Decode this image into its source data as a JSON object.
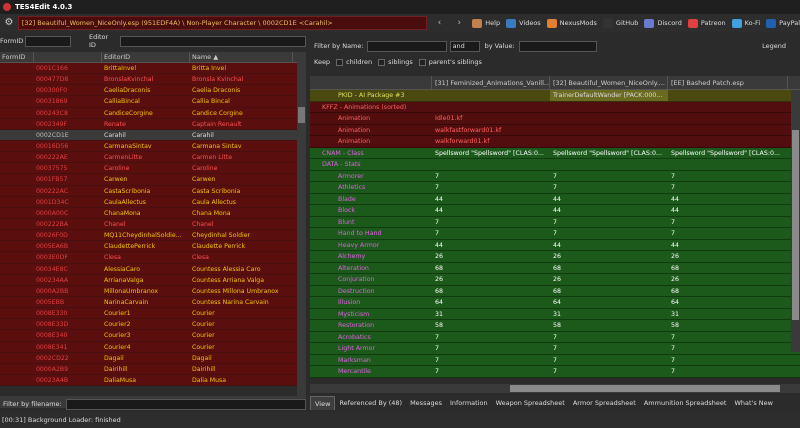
{
  "window": {
    "title": "TES4Edit 4.0.3"
  },
  "toolbar": {
    "path": "[32] Beautiful_Women_NiceOnly.esp (951EDF4A) \\ Non-Player Character \\ 0002CD1E <Carahil>",
    "buttons": [
      {
        "label": "Help",
        "icon": "book-icon",
        "color": "#c08050"
      },
      {
        "label": "Videos",
        "icon": "video-icon",
        "color": "#3a7ac0"
      },
      {
        "label": "NexusMods",
        "icon": "nexus-icon",
        "color": "#e08030"
      },
      {
        "label": "GitHub",
        "icon": "github-icon",
        "color": "#333333"
      },
      {
        "label": "Discord",
        "icon": "discord-icon",
        "color": "#6a7ad0"
      },
      {
        "label": "Patreon",
        "icon": "patreon-icon",
        "color": "#e04040"
      },
      {
        "label": "Ko-Fi",
        "icon": "kofi-icon",
        "color": "#40a0e0"
      },
      {
        "label": "PayPal",
        "icon": "paypal-icon",
        "color": "#2060b0"
      }
    ]
  },
  "left": {
    "formid_label": "FormID",
    "editorid_label": "Editor ID",
    "columns": [
      "FormID",
      "EditorID",
      "Name ▲"
    ],
    "rows": [
      {
        "id": "0001C166",
        "eid": "BrittaInvel",
        "name": "Britta Invel",
        "red": false
      },
      {
        "id": "000477D8",
        "eid": "BronslaKvinchal",
        "name": "Bronsla Kvinchal",
        "red": true
      },
      {
        "id": "000300F0",
        "eid": "CaeliaDraconis",
        "name": "Caelia Draconis",
        "red": false
      },
      {
        "id": "00031869",
        "eid": "CalliaBincal",
        "name": "Callia Bincal",
        "red": false
      },
      {
        "id": "000243C8",
        "eid": "CandiceCorgine",
        "name": "Candice Corgine",
        "red": false
      },
      {
        "id": "0002349F",
        "eid": "Renate",
        "name": "Captain Renault",
        "red": true
      },
      {
        "id": "0002CD1E",
        "eid": "Carahil",
        "name": "Carahil",
        "red": false,
        "sel": true
      },
      {
        "id": "00016D56",
        "eid": "CarmanaSintav",
        "name": "Carmana Sintav",
        "red": false
      },
      {
        "id": "000222AE",
        "eid": "CarmenLitte",
        "name": "Carmen Litte",
        "red": true
      },
      {
        "id": "00037575",
        "eid": "Caroline",
        "name": "Caroline",
        "red": true
      },
      {
        "id": "0001FB57",
        "eid": "Carwen",
        "name": "Carwen",
        "red": false
      },
      {
        "id": "000222AC",
        "eid": "CastaScribonia",
        "name": "Casta Scribonia",
        "red": false
      },
      {
        "id": "0001D34C",
        "eid": "CaulaAllectus",
        "name": "Caula Allectus",
        "red": false
      },
      {
        "id": "0000A00C",
        "eid": "ChanaMona",
        "name": "Chana Mona",
        "red": false
      },
      {
        "id": "000222BA",
        "eid": "Chanel",
        "name": "Chanel",
        "red": true
      },
      {
        "id": "00026F0D",
        "eid": "MQ11CheydinhalSoldie...",
        "name": "Cheydinhal Soldier",
        "red": false
      },
      {
        "id": "0005EA6B",
        "eid": "ClaudettePerrick",
        "name": "Claudette Perrick",
        "red": false
      },
      {
        "id": "0003E0DF",
        "eid": "Clesa",
        "name": "Clesa",
        "red": true
      },
      {
        "id": "00034E8C",
        "eid": "AlessiaCaro",
        "name": "Countess Alessia Caro",
        "red": false
      },
      {
        "id": "000234AA",
        "eid": "ArrianaValga",
        "name": "Countess Arriana Valga",
        "red": false
      },
      {
        "id": "0000A2BB",
        "eid": "MillonaUmbranox",
        "name": "Countess Millona Umbranox",
        "red": false
      },
      {
        "id": "0005EBB",
        "eid": "NarinaCarvain",
        "name": "Countess Narina Carvain",
        "red": false
      },
      {
        "id": "0008E330",
        "eid": "Courier1",
        "name": "Courier",
        "red": false
      },
      {
        "id": "0008E33D",
        "eid": "Courier2",
        "name": "Courier",
        "red": false
      },
      {
        "id": "0008E340",
        "eid": "Courier3",
        "name": "Courier",
        "red": false
      },
      {
        "id": "0008E341",
        "eid": "Courier4",
        "name": "Courier",
        "red": false
      },
      {
        "id": "0002CD22",
        "eid": "Dagail",
        "name": "Dagail",
        "red": false
      },
      {
        "id": "0000A2B9",
        "eid": "Dairihill",
        "name": "Dairihill",
        "red": false
      },
      {
        "id": "00023A4B",
        "eid": "DaliaMusa",
        "name": "Dalia Musa",
        "red": false
      }
    ],
    "filter_label": "Filter by filename:"
  },
  "right": {
    "filter_name_label": "Filter by Name:",
    "and_label": "and",
    "value_label": "by Value:",
    "legend_label": "Legend",
    "keep_label": "Keep",
    "children_label": "children",
    "siblings_label": "siblings",
    "parent_siblings_label": "parent's siblings",
    "columns": [
      "",
      "[31] Feminized_Animations_Vanill...",
      "[32] Beautiful_Women_NiceOnly....",
      "[EE] Bashed Patch.esp"
    ],
    "rows": [
      {
        "k": "olive",
        "i": 1,
        "c": [
          "PKID - AI Package #3",
          "",
          "TrainerDefaultWander [PACK:000...",
          ""
        ]
      },
      {
        "k": "maroon",
        "i": 0,
        "c": [
          "KFFZ - Animations (sorted)",
          "",
          "",
          ""
        ]
      },
      {
        "k": "maroon",
        "i": 1,
        "c": [
          "Animation",
          "Idle01.kf",
          "",
          ""
        ]
      },
      {
        "k": "maroon",
        "i": 1,
        "c": [
          "Animation",
          "walkfastforward01.kf",
          "",
          ""
        ]
      },
      {
        "k": "maroon",
        "i": 1,
        "c": [
          "Animation",
          "walkforward01.kf",
          "",
          ""
        ]
      },
      {
        "k": "green",
        "i": 0,
        "c": [
          "CNAM - Class",
          "Spellsword \"Spellsword\" [CLAS:0...",
          "Spellsword \"Spellsword\" [CLAS:0...",
          "Spellsword \"Spellsword\" [CLAS:0..."
        ]
      },
      {
        "k": "green",
        "i": 0,
        "c": [
          "DATA - Stats",
          "",
          "",
          ""
        ]
      },
      {
        "k": "green",
        "i": 1,
        "c": [
          "Armorer",
          "7",
          "7",
          "7"
        ]
      },
      {
        "k": "green",
        "i": 1,
        "c": [
          "Athletics",
          "7",
          "7",
          "7"
        ]
      },
      {
        "k": "green",
        "i": 1,
        "c": [
          "Blade",
          "44",
          "44",
          "44"
        ]
      },
      {
        "k": "green",
        "i": 1,
        "c": [
          "Block",
          "44",
          "44",
          "44"
        ]
      },
      {
        "k": "green",
        "i": 1,
        "c": [
          "Blunt",
          "7",
          "7",
          "7"
        ]
      },
      {
        "k": "green",
        "i": 1,
        "c": [
          "Hand to Hand",
          "7",
          "7",
          "7"
        ]
      },
      {
        "k": "green",
        "i": 1,
        "c": [
          "Heavy Armor",
          "44",
          "44",
          "44"
        ]
      },
      {
        "k": "green",
        "i": 1,
        "c": [
          "Alchemy",
          "26",
          "26",
          "26"
        ]
      },
      {
        "k": "green",
        "i": 1,
        "c": [
          "Alteration",
          "68",
          "68",
          "68"
        ]
      },
      {
        "k": "green",
        "i": 1,
        "c": [
          "Conjuration",
          "26",
          "26",
          "26"
        ]
      },
      {
        "k": "green",
        "i": 1,
        "c": [
          "Destruction",
          "68",
          "68",
          "68"
        ]
      },
      {
        "k": "green",
        "i": 1,
        "c": [
          "Illusion",
          "64",
          "64",
          "64"
        ]
      },
      {
        "k": "green",
        "i": 1,
        "c": [
          "Mysticism",
          "31",
          "31",
          "31"
        ]
      },
      {
        "k": "green",
        "i": 1,
        "c": [
          "Restoration",
          "58",
          "58",
          "58"
        ]
      },
      {
        "k": "green",
        "i": 1,
        "c": [
          "Acrobatics",
          "7",
          "7",
          "7"
        ]
      },
      {
        "k": "green",
        "i": 1,
        "c": [
          "Light Armor",
          "7",
          "7",
          "7"
        ]
      },
      {
        "k": "green",
        "i": 1,
        "c": [
          "Marksman",
          "7",
          "7",
          "7"
        ]
      },
      {
        "k": "green",
        "i": 1,
        "c": [
          "Mercantile",
          "7",
          "7",
          "7"
        ]
      }
    ],
    "tabs": [
      "View",
      "Referenced By (48)",
      "Messages",
      "Information",
      "Weapon Spreadsheet",
      "Armor Spreadsheet",
      "Ammunition Spreadsheet",
      "What's New"
    ]
  },
  "status": "[00:31] Background Loader: finished"
}
